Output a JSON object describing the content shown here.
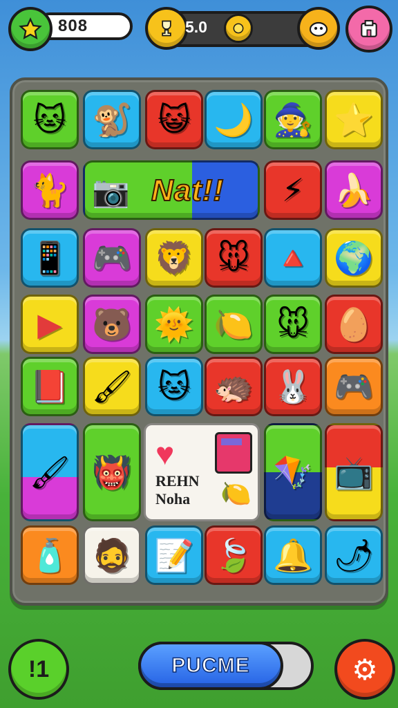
{
  "hud": {
    "score": "808",
    "coin_value": "5.0",
    "icons": {
      "star": "star-icon",
      "coin": "coin-icon",
      "mascot": "mascot-icon",
      "shop": "shop-icon"
    }
  },
  "banner": {
    "text": "Nat!!"
  },
  "card": {
    "line1": "REHN",
    "line2": "Noha"
  },
  "tiles": [
    {
      "glyph": "🐱"
    },
    {
      "glyph": "🐒"
    },
    {
      "glyph": "😺"
    },
    {
      "glyph": "🌙"
    },
    {
      "glyph": "🧙"
    },
    {
      "glyph": "⭐"
    },
    {
      "glyph": "🐈"
    },
    {
      "glyph": "⚡"
    },
    {
      "glyph": "🍌"
    },
    {
      "glyph": "📱"
    },
    {
      "glyph": "🎮"
    },
    {
      "glyph": "🦁"
    },
    {
      "glyph": "🐭"
    },
    {
      "glyph": "🔺"
    },
    {
      "glyph": "🌍"
    },
    {
      "glyph": "▶"
    },
    {
      "glyph": "🐻"
    },
    {
      "glyph": "🌞"
    },
    {
      "glyph": "🍋"
    },
    {
      "glyph": "🐭"
    },
    {
      "glyph": "🥚"
    },
    {
      "glyph": "📕"
    },
    {
      "glyph": "🖌"
    },
    {
      "glyph": "🐱"
    },
    {
      "glyph": "🦔"
    },
    {
      "glyph": "🐰"
    },
    {
      "glyph": "🎮"
    },
    {
      "glyph": "🖌"
    },
    {
      "glyph": "👹"
    },
    {
      "glyph": "🪁"
    },
    {
      "glyph": "📺"
    },
    {
      "glyph": "🧴"
    },
    {
      "glyph": "🧔"
    },
    {
      "glyph": "📝"
    },
    {
      "glyph": "🍃"
    },
    {
      "glyph": "🔔"
    },
    {
      "glyph": "🌶"
    }
  ],
  "bottom": {
    "left_label": "!1",
    "main_label": "PUCME",
    "right_icon": "gear-icon"
  }
}
